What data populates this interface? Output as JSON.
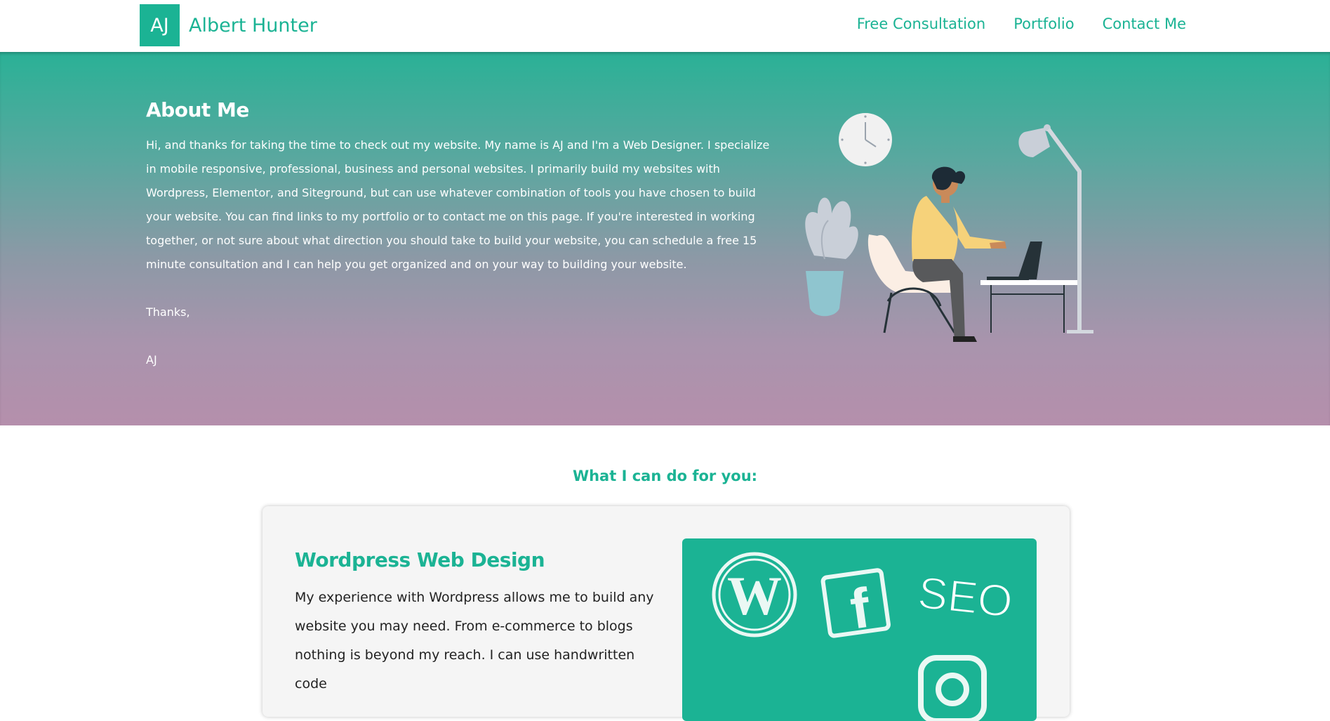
{
  "header": {
    "logo_text": "AJ",
    "brand_name": "Albert Hunter",
    "nav": [
      {
        "label": "Free Consultation"
      },
      {
        "label": "Portfolio"
      },
      {
        "label": "Contact Me"
      }
    ]
  },
  "hero": {
    "title": "About Me",
    "body": "Hi, and thanks for taking the time to check out my website. My name is AJ and I'm a Web Designer. I specialize in mobile responsive, professional, business and personal websites. I primarily build my websites with Wordpress, Elementor, and Siteground, but can use whatever combination of tools you have chosen to build your website. You can find links to my portfolio or to contact me on this page. If you're interested in working together, or not sure about what direction you should take to build your website, you can schedule a free 15 minute consultation and I can help you get organized and on your way to building your website.",
    "thanks": "Thanks,",
    "signature": "AJ"
  },
  "services": {
    "heading": "What I can do for you:",
    "card": {
      "title": "Wordpress Web Design",
      "body": "My experience with Wordpress allows me to build any website you may need. From e-commerce to blogs nothing is beyond my reach. I can use handwritten code",
      "media_text": "SEO"
    }
  },
  "colors": {
    "accent": "#1bb394",
    "hero_top": "#2ab196",
    "hero_bottom": "#b58fac"
  }
}
